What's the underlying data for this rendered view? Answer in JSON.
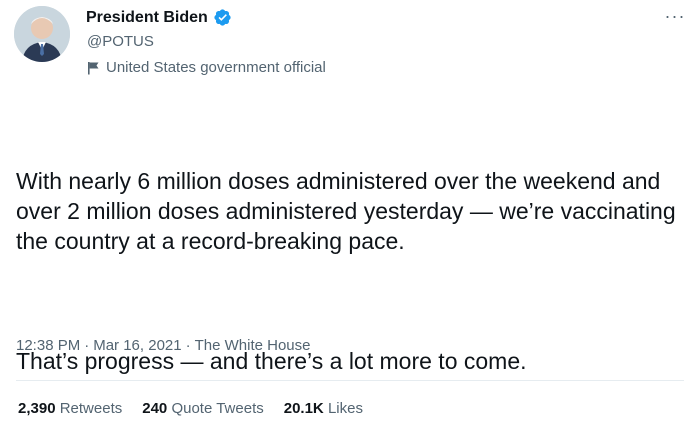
{
  "author": {
    "display_name": "President Biden",
    "handle": "@POTUS",
    "label": "United States government official"
  },
  "tweet": {
    "paragraph1": "With nearly 6 million doses administered over the weekend and over 2 million doses administered yesterday — we’re vaccinating the country at a record-breaking pace.",
    "paragraph2": "That’s progress — and there’s a lot more to come."
  },
  "meta": {
    "time": "12:38 PM",
    "sep": "·",
    "date": "Mar 16, 2021",
    "source": "The White House"
  },
  "stats": {
    "retweets_count": "2,390",
    "retweets_label": "Retweets",
    "quotes_count": "240",
    "quotes_label": "Quote Tweets",
    "likes_count": "20.1K",
    "likes_label": "Likes"
  },
  "colors": {
    "verified": "#1d9bf0",
    "secondary_text": "#536471"
  },
  "icons": {
    "more": "more-icon",
    "verified": "verified-badge-icon",
    "government_label": "flag-icon"
  }
}
